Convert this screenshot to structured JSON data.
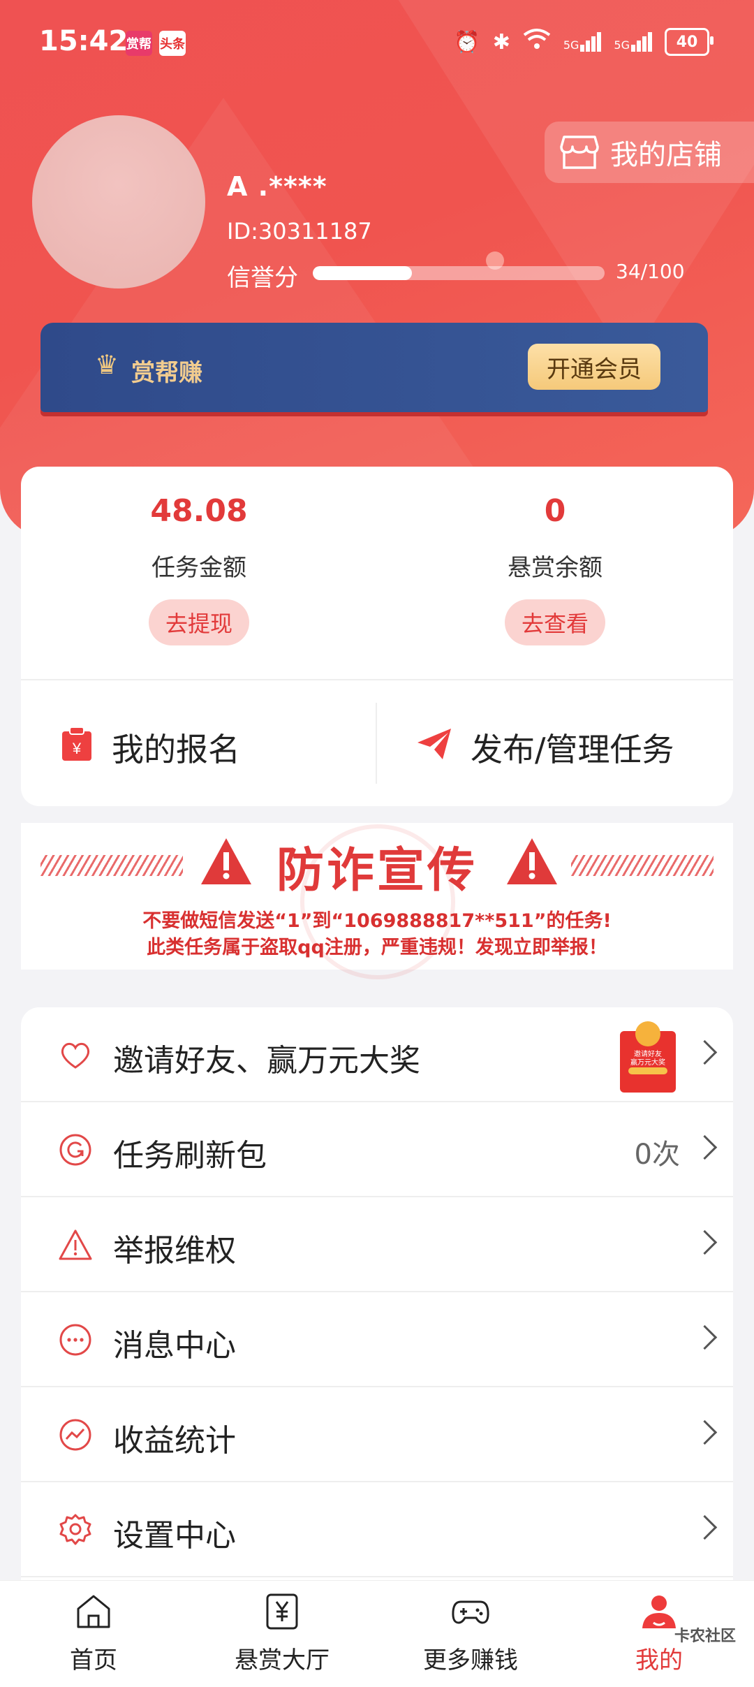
{
  "status_bar": {
    "time": "15:42",
    "badge1": "赏帮",
    "badge2": "头条",
    "battery": "40"
  },
  "profile": {
    "name": "A   .****",
    "id": "ID:30311187",
    "credit_label": "信誉分",
    "credit_value": "34/100",
    "credit_fraction": 0.34,
    "store_label": "我的店铺"
  },
  "vip": {
    "title": "赏帮赚",
    "button": "开通会员"
  },
  "balance": {
    "task_amount": "48.08",
    "task_label": "任务金额",
    "task_button": "去提现",
    "reward_amount": "0",
    "reward_label": "悬赏余额",
    "reward_button": "去查看"
  },
  "actions": {
    "my_signup": "我的报名",
    "publish": "发布/管理任务"
  },
  "fraud": {
    "title": "防诈宣传",
    "line1": "不要做短信发送“1”到“1069888817**511”的任务!",
    "line2": "此类任务属于盗取qq注册，严重违规！发现立即举报！"
  },
  "menu": [
    {
      "label": "邀请好友、赢万元大奖",
      "extra": "",
      "icon": "heart-icon"
    },
    {
      "label": "任务刷新包",
      "extra": "0次",
      "icon": "refresh-icon"
    },
    {
      "label": "举报维权",
      "extra": "",
      "icon": "warning-icon"
    },
    {
      "label": "消息中心",
      "extra": "",
      "icon": "message-icon"
    },
    {
      "label": "收益统计",
      "extra": "",
      "icon": "chart-icon"
    },
    {
      "label": "设置中心",
      "extra": "",
      "icon": "settings-icon"
    }
  ],
  "promo": {
    "line1": "邀请好友",
    "line2": "赢万元大奖"
  },
  "tabs": [
    {
      "label": "首页",
      "icon": "home-icon"
    },
    {
      "label": "悬赏大厅",
      "icon": "yuan-icon"
    },
    {
      "label": "更多赚钱",
      "icon": "gamepad-icon"
    },
    {
      "label": "我的",
      "icon": "user-icon"
    }
  ],
  "watermark": "卡农社区",
  "colors": {
    "primary": "#e23a3a",
    "vip_blue": "#2f4a8a",
    "vip_gold": "#f5c97a"
  }
}
